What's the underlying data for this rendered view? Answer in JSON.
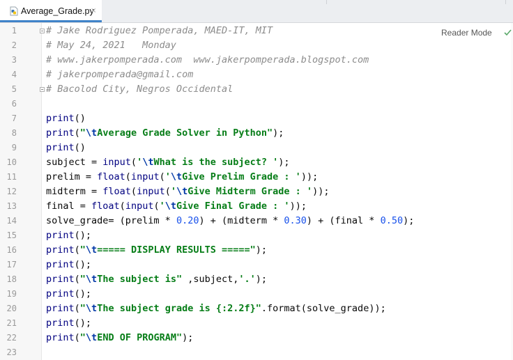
{
  "tab": {
    "label": "Average_Grade.py",
    "close": "×"
  },
  "editor": {
    "reader_mode": "Reader Mode",
    "lines": [
      {
        "n": "1",
        "segs": [
          {
            "t": "# Jake Rodriguez Pomperada, MAED-IT, MIT",
            "c": "cm"
          }
        ],
        "fold": true
      },
      {
        "n": "2",
        "segs": [
          {
            "t": "# May 24, 2021   Monday",
            "c": "cm"
          }
        ]
      },
      {
        "n": "3",
        "segs": [
          {
            "t": "# www.jakerpomperada.com  www.jakerpomperada.blogspot.com",
            "c": "cm"
          }
        ]
      },
      {
        "n": "4",
        "segs": [
          {
            "t": "# jakerpomperada@gmail.com",
            "c": "cm"
          }
        ]
      },
      {
        "n": "5",
        "segs": [
          {
            "t": "# Bacolod City, Negros Occidental",
            "c": "cm"
          }
        ],
        "fold": true
      },
      {
        "n": "6",
        "segs": []
      },
      {
        "n": "7",
        "segs": [
          {
            "t": "print",
            "c": "fn"
          },
          {
            "t": "()",
            "c": ""
          }
        ]
      },
      {
        "n": "8",
        "segs": [
          {
            "t": "print",
            "c": "fn"
          },
          {
            "t": "(",
            "c": ""
          },
          {
            "t": "\"",
            "c": "st"
          },
          {
            "t": "\\t",
            "c": "es"
          },
          {
            "t": "Average Grade Solver in Python\"",
            "c": "st"
          },
          {
            "t": ");",
            "c": ""
          }
        ]
      },
      {
        "n": "9",
        "segs": [
          {
            "t": "print",
            "c": "fn"
          },
          {
            "t": "()",
            "c": ""
          }
        ]
      },
      {
        "n": "10",
        "segs": [
          {
            "t": "subject = ",
            "c": ""
          },
          {
            "t": "input",
            "c": "fn"
          },
          {
            "t": "(",
            "c": ""
          },
          {
            "t": "'",
            "c": "st"
          },
          {
            "t": "\\t",
            "c": "es"
          },
          {
            "t": "What is the subject? '",
            "c": "st"
          },
          {
            "t": ");",
            "c": ""
          }
        ]
      },
      {
        "n": "11",
        "segs": [
          {
            "t": "prelim = ",
            "c": ""
          },
          {
            "t": "float",
            "c": "fn"
          },
          {
            "t": "(",
            "c": ""
          },
          {
            "t": "input",
            "c": "fn"
          },
          {
            "t": "(",
            "c": ""
          },
          {
            "t": "'",
            "c": "st"
          },
          {
            "t": "\\t",
            "c": "es"
          },
          {
            "t": "Give Prelim Grade : '",
            "c": "st"
          },
          {
            "t": "));",
            "c": ""
          }
        ]
      },
      {
        "n": "12",
        "segs": [
          {
            "t": "midterm = ",
            "c": ""
          },
          {
            "t": "float",
            "c": "fn"
          },
          {
            "t": "(",
            "c": ""
          },
          {
            "t": "input",
            "c": "fn"
          },
          {
            "t": "(",
            "c": ""
          },
          {
            "t": "'",
            "c": "st"
          },
          {
            "t": "\\t",
            "c": "es"
          },
          {
            "t": "Give Midterm Grade : '",
            "c": "st"
          },
          {
            "t": "));",
            "c": ""
          }
        ]
      },
      {
        "n": "13",
        "segs": [
          {
            "t": "final = ",
            "c": ""
          },
          {
            "t": "float",
            "c": "fn"
          },
          {
            "t": "(",
            "c": ""
          },
          {
            "t": "input",
            "c": "fn"
          },
          {
            "t": "(",
            "c": ""
          },
          {
            "t": "'",
            "c": "st"
          },
          {
            "t": "\\t",
            "c": "es"
          },
          {
            "t": "Give Final Grade : '",
            "c": "st"
          },
          {
            "t": "));",
            "c": ""
          }
        ]
      },
      {
        "n": "14",
        "segs": [
          {
            "t": "solve_grade= (prelim * ",
            "c": ""
          },
          {
            "t": "0.20",
            "c": "nm"
          },
          {
            "t": ") + (midterm * ",
            "c": ""
          },
          {
            "t": "0.30",
            "c": "nm"
          },
          {
            "t": ") + (final * ",
            "c": ""
          },
          {
            "t": "0.50",
            "c": "nm"
          },
          {
            "t": ");",
            "c": ""
          }
        ]
      },
      {
        "n": "15",
        "segs": [
          {
            "t": "print",
            "c": "fn"
          },
          {
            "t": "();",
            "c": ""
          }
        ]
      },
      {
        "n": "16",
        "segs": [
          {
            "t": "print",
            "c": "fn"
          },
          {
            "t": "(",
            "c": ""
          },
          {
            "t": "\"",
            "c": "st"
          },
          {
            "t": "\\t",
            "c": "es"
          },
          {
            "t": "===== DISPLAY RESULTS =====\"",
            "c": "st"
          },
          {
            "t": ");",
            "c": ""
          }
        ]
      },
      {
        "n": "17",
        "segs": [
          {
            "t": "print",
            "c": "fn"
          },
          {
            "t": "();",
            "c": ""
          }
        ]
      },
      {
        "n": "18",
        "segs": [
          {
            "t": "print",
            "c": "fn"
          },
          {
            "t": "(",
            "c": ""
          },
          {
            "t": "\"",
            "c": "st"
          },
          {
            "t": "\\t",
            "c": "es"
          },
          {
            "t": "The subject is\"",
            "c": "st"
          },
          {
            "t": " ,subject,",
            "c": ""
          },
          {
            "t": "'.'",
            "c": "st"
          },
          {
            "t": ");",
            "c": ""
          }
        ]
      },
      {
        "n": "19",
        "segs": [
          {
            "t": "print",
            "c": "fn"
          },
          {
            "t": "();",
            "c": ""
          }
        ]
      },
      {
        "n": "20",
        "segs": [
          {
            "t": "print",
            "c": "fn"
          },
          {
            "t": "(",
            "c": ""
          },
          {
            "t": "\"",
            "c": "st"
          },
          {
            "t": "\\t",
            "c": "es"
          },
          {
            "t": "The subject grade is {:2.2f}\"",
            "c": "st"
          },
          {
            "t": ".format(solve_grade));",
            "c": ""
          }
        ]
      },
      {
        "n": "21",
        "segs": [
          {
            "t": "print",
            "c": "fn"
          },
          {
            "t": "();",
            "c": ""
          }
        ]
      },
      {
        "n": "22",
        "segs": [
          {
            "t": "print",
            "c": "fn"
          },
          {
            "t": "(",
            "c": ""
          },
          {
            "t": "\"",
            "c": "st"
          },
          {
            "t": "\\t",
            "c": "es"
          },
          {
            "t": "END OF PROGRAM\"",
            "c": "st"
          },
          {
            "t": ");",
            "c": ""
          }
        ]
      },
      {
        "n": "23",
        "segs": []
      }
    ]
  },
  "icons": {
    "file_icon": "python-file-icon",
    "check": "check-icon"
  },
  "colors": {
    "comment": "#8c8c8c",
    "builtin": "#000080",
    "string": "#067d17",
    "escape": "#0037a6",
    "number": "#1750eb",
    "tab_underline": "#4083c9"
  }
}
